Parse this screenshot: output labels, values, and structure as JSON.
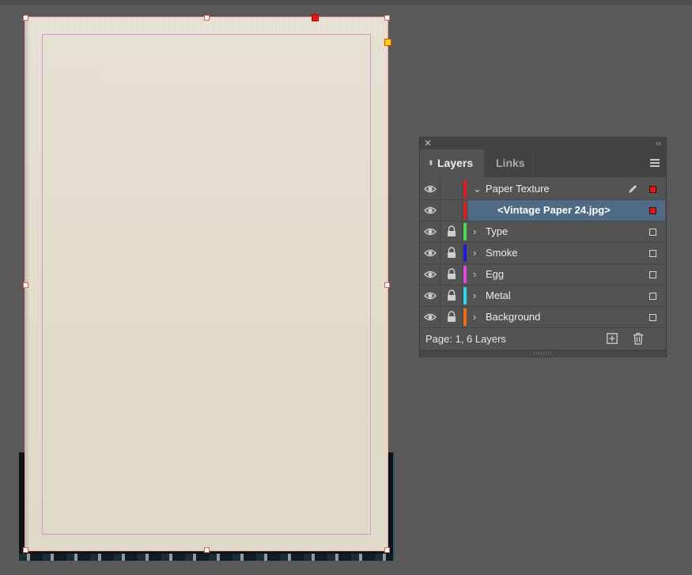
{
  "colors": {
    "pasteboard": "#595959",
    "panel_bg": "#535353",
    "selected_row": "#4f6a86",
    "margin_guide": "#e38ee0"
  },
  "layers_panel": {
    "tabs": [
      {
        "label": "Layers",
        "active": true
      },
      {
        "label": "Links",
        "active": false
      }
    ],
    "layers": [
      {
        "name": "Paper Texture",
        "expanded": true,
        "visible": true,
        "locked": false,
        "color": "#e01b1b",
        "selected_square": true,
        "target_icon": "pen-icon"
      },
      {
        "name": "<Vintage Paper 24.jpg>",
        "child": true,
        "visible": true,
        "locked": false,
        "color": "#e01b1b",
        "selected_square": true,
        "highlighted": true
      },
      {
        "name": "Type",
        "expanded": false,
        "visible": true,
        "locked": true,
        "color": "#4bd64b",
        "selected_square": false
      },
      {
        "name": "Smoke",
        "expanded": false,
        "visible": true,
        "locked": true,
        "color": "#1a1adc",
        "selected_square": false
      },
      {
        "name": "Egg",
        "expanded": false,
        "visible": true,
        "locked": true,
        "color": "#e048dc",
        "selected_square": false
      },
      {
        "name": "Metal",
        "expanded": false,
        "visible": true,
        "locked": true,
        "color": "#27d8e6",
        "selected_square": false
      },
      {
        "name": "Background",
        "expanded": false,
        "visible": true,
        "locked": true,
        "color": "#f06a10",
        "selected_square": false
      }
    ],
    "footer": {
      "status": "Page: 1, 6 Layers"
    }
  }
}
